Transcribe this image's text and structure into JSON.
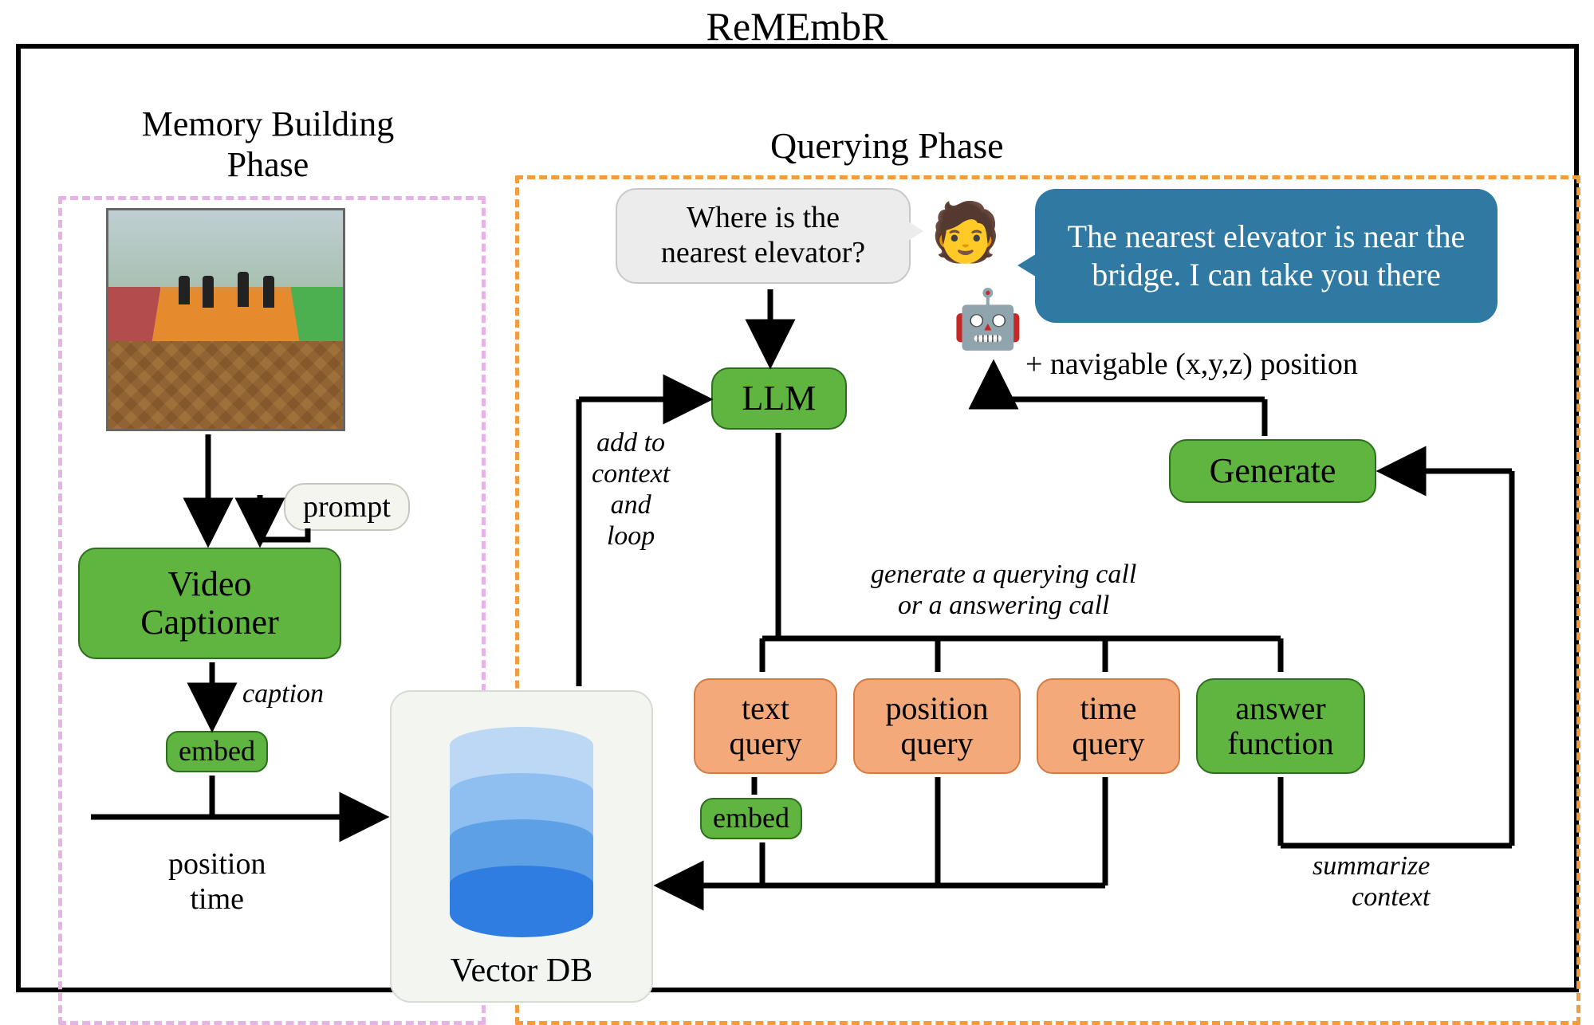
{
  "title": "ReMEmbR",
  "phases": {
    "memory_title": "Memory Building\nPhase",
    "query_title": "Querying Phase"
  },
  "memory": {
    "prompt_label": "prompt",
    "video_captioner": "Video\nCaptioner",
    "caption_label": "caption",
    "embed_label": "embed",
    "position_time": "position\ntime"
  },
  "vectordb": {
    "label": "Vector DB"
  },
  "query": {
    "user_question": "Where is the\nnearest elevator?",
    "bot_answer": "The nearest elevator is near the bridge. I can take you there",
    "nav_note": "+ navigable (x,y,z) position",
    "llm_label": "LLM",
    "add_context_note": "add to\ncontext\nand\nloop",
    "gen_call_note": "generate a querying call\nor a answering call",
    "generate_label": "Generate",
    "text_query": "text\nquery",
    "position_query": "position\nquery",
    "time_query": "time\nquery",
    "answer_function": "answer\nfunction",
    "embed_label": "embed",
    "summarize_note": "summarize\ncontext"
  },
  "emoji": {
    "user": "🧑",
    "robot": "🤖"
  },
  "colors": {
    "green": "#5fb53f",
    "orange_block": "#f4a97a",
    "orange_dash": "#f29b3f",
    "pink_dash": "#e6b3e6",
    "bot_bubble": "#2f79a3"
  }
}
